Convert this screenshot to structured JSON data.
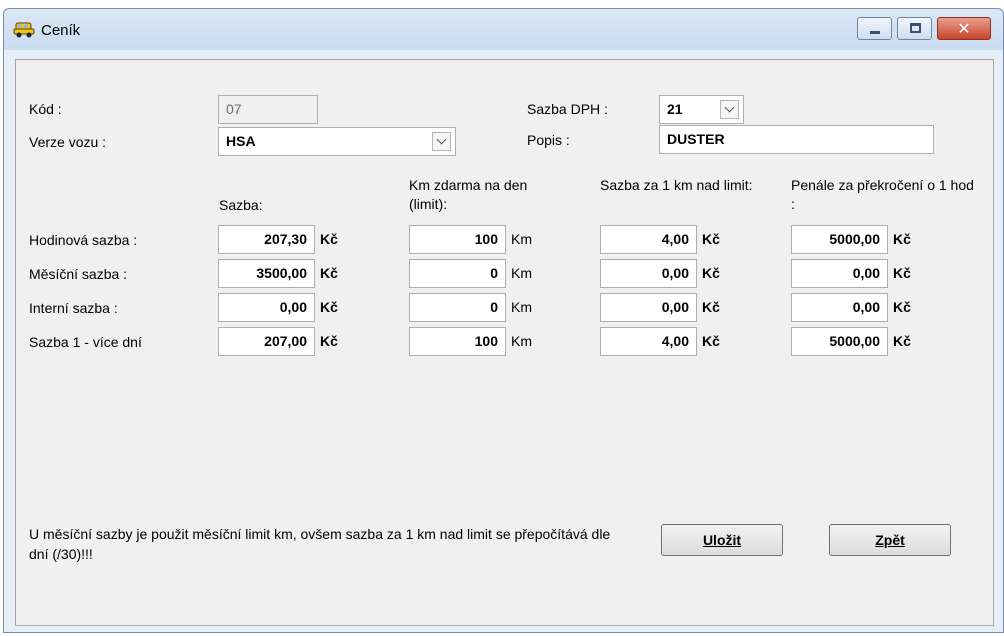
{
  "window": {
    "title": "Ceník",
    "close_symbol": "✕",
    "colors": {
      "titlebar": "#c9dbf0",
      "close": "#c7442a",
      "client": "#f0f0f0"
    }
  },
  "form": {
    "kod_label": "Kód :",
    "kod_value": "07",
    "verze_label": "Verze vozu :",
    "verze_value": "HSA",
    "dph_label": "Sazba DPH :",
    "dph_value": "21",
    "popis_label": "Popis :",
    "popis_value": "DUSTER"
  },
  "columns": {
    "sazba": "Sazba:",
    "km_zdarma": "Km zdarma na den (limit):",
    "sazba_km": "Sazba za 1 km nad limit:",
    "penale": "Penále za překročení o 1 hod :"
  },
  "rows": [
    {
      "label": "Hodinová sazba :",
      "sazba": "207,30",
      "km": "100",
      "sazba_km": "4,00",
      "penale": "5000,00"
    },
    {
      "label": "Měsíční sazba :",
      "sazba": "3500,00",
      "km": "0",
      "sazba_km": "0,00",
      "penale": "0,00"
    },
    {
      "label": "Interní sazba :",
      "sazba": "0,00",
      "km": "0",
      "sazba_km": "0,00",
      "penale": "0,00"
    },
    {
      "label": "Sazba 1 - více dní",
      "sazba": "207,00",
      "km": "100",
      "sazba_km": "4,00",
      "penale": "5000,00"
    }
  ],
  "units": {
    "currency": "Kč",
    "km": "Km"
  },
  "note": "U měsíční sazby je použit měsíční limit km, ovšem sazba za 1 km nad limit se přepočítává dle dní (/30)!!!",
  "buttons": {
    "save": "Uložit",
    "back": "Zpět"
  }
}
